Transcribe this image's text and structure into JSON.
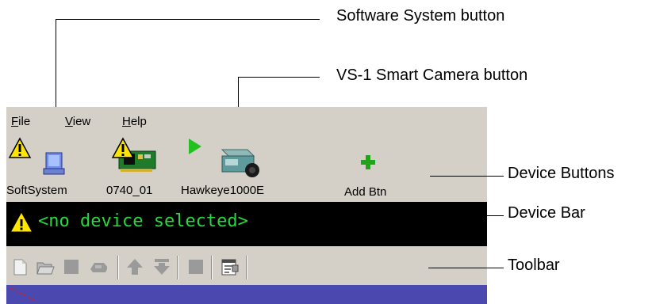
{
  "menu": {
    "file": {
      "first": "F",
      "rest": "ile"
    },
    "view": {
      "first": "V",
      "rest": "iew"
    },
    "help": {
      "first": "H",
      "rest": "elp"
    }
  },
  "devices": [
    {
      "label": "SoftSystem",
      "icon": "monitor-warning-icon"
    },
    {
      "label": "0740_01",
      "icon": "circuit-board-warning-icon"
    },
    {
      "label": "Hawkeye1000E",
      "icon": "camera-play-icon"
    },
    {
      "label": "Add Btn",
      "icon": "add-plus-icon"
    }
  ],
  "device_bar": {
    "text": "<no device selected>",
    "color": "#27d83e"
  },
  "toolbar_icons": [
    "new-file-icon",
    "open-folder-icon",
    "stop-icon",
    "chip-icon",
    "upload-icon",
    "download-icon",
    "stop-icon",
    "properties-icon"
  ],
  "callouts": {
    "software_system": "Software System button",
    "smart_camera": "VS-1 Smart Camera button",
    "device_buttons": "Device Buttons",
    "device_bar": "Device Bar",
    "toolbar": "Toolbar"
  },
  "colors": {
    "window_bg": "#d4d0c8",
    "status_blue": "#4b48b0",
    "warning_yellow": "#ffe600",
    "play_green": "#22c020"
  }
}
